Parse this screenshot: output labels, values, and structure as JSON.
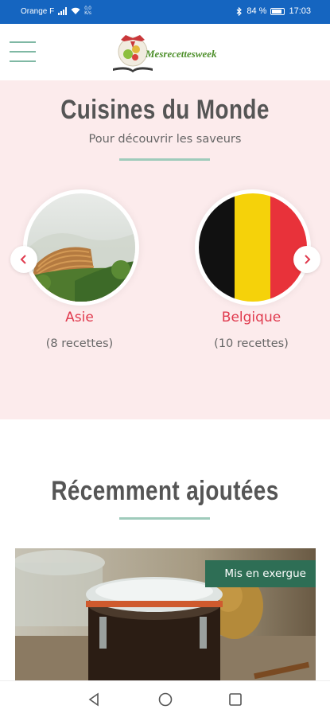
{
  "status_bar": {
    "carrier": "Orange F",
    "speed_value": "0,0",
    "speed_unit": "K/s",
    "battery": "84 %",
    "time": "17:03"
  },
  "header": {
    "logo_text": "Mesrecettesweek"
  },
  "world_cuisines": {
    "title": "Cuisines du Monde",
    "subtitle": "Pour découvrir les saveurs",
    "items": [
      {
        "name": "Asie",
        "count": "(8 recettes)"
      },
      {
        "name": "Belgique",
        "count": "(10 recettes)"
      }
    ]
  },
  "recent": {
    "title": "Récemment ajoutées",
    "badge": "Mis en exergue"
  },
  "icons": {
    "menu": "hamburger-icon",
    "prev": "chevron-left-icon",
    "next": "chevron-right-icon",
    "back": "triangle-back-icon",
    "home": "circle-home-icon",
    "recents": "square-recents-icon"
  },
  "colors": {
    "status_bar": "#1565c0",
    "section_bg": "#fcebec",
    "accent_red": "#e03a4e",
    "accent_green": "#9fcbbb",
    "badge_green": "#2e6e55"
  }
}
